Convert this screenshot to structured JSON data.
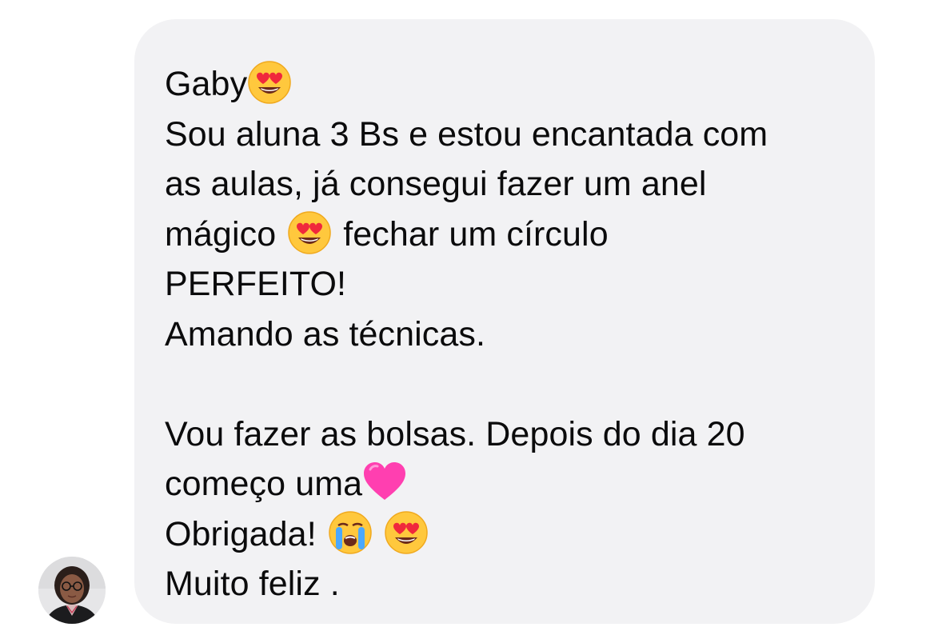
{
  "message": {
    "lines": {
      "l1": "Gaby",
      "l2": "Sou aluna 3 Bs e estou encantada com",
      "l3": "as aulas, já consegui fazer um anel",
      "l4a": "mágico",
      "l4b": "fechar um círculo",
      "l5": "PERFEITO!",
      "l6": "Amando as técnicas.",
      "l7": "Vou fazer as bolsas. Depois do dia 20",
      "l8": "começo uma",
      "l9": "Obrigada!",
      "l10": "Muito feliz ."
    },
    "emojis": {
      "heart_eyes": "heart-eyes-emoji",
      "pink_heart": "pink-heart-emoji",
      "crying": "loudly-crying-emoji"
    }
  },
  "sender": {
    "avatar": "sender-avatar"
  },
  "colors": {
    "bubble_bg": "#f2f2f4",
    "text": "#0b0b0c",
    "page_bg": "#ffffff"
  }
}
